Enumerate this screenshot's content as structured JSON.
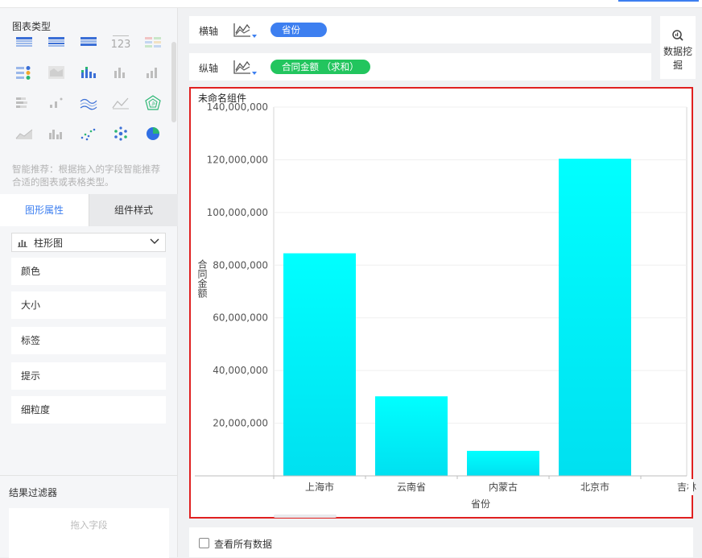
{
  "left_panel": {
    "chart_types_title": "图表类型",
    "hint": "智能推荐：根据拖入的字段智能推荐合适的图表或表格类型。",
    "tabs": [
      "图形属性",
      "组件样式"
    ],
    "chart_select": "柱形图",
    "properties": [
      "颜色",
      "大小",
      "标签",
      "提示",
      "细粒度"
    ],
    "filter_title": "结果过滤器",
    "filter_placeholder": "拖入字段",
    "icon_names": [
      "cross-table-icon",
      "group-table-icon",
      "detail-table-icon",
      "kpi-number-icon",
      "colored-table-icon",
      "multi-indicator-icon",
      "map-icon",
      "stacked-bar-icon",
      "bar-chart-icon",
      "column-chart-icon",
      "range-bar-icon",
      "scatter-bar-icon",
      "multi-line-icon",
      "line-chart-icon",
      "radar-icon",
      "area-chart-icon",
      "grouped-column-icon",
      "scatter-icon",
      "bubble-icon",
      "pie-chart-icon"
    ],
    "icon_123_text": "123"
  },
  "axes": {
    "x_label": "横轴",
    "x_field": "省份",
    "y_label": "纵轴",
    "y_field": "合同金额 （求和）"
  },
  "data_mining": "数据挖掘",
  "component_title": "未命名组件",
  "show_all_data": "查看所有数据",
  "colors": {
    "accent": "#3d7ff0",
    "green": "#22c55e",
    "bar_top": "#00ffff",
    "bar_bottom": "#00e0f0",
    "highlight": "#e02020"
  },
  "chart_data": {
    "type": "bar",
    "categories": [
      "上海市",
      "云南省",
      "内蒙古",
      "北京市",
      "吉林"
    ],
    "values": [
      84500000,
      30200000,
      9500000,
      120400000,
      null
    ],
    "xlabel": "省份",
    "ylabel": "合同金额",
    "ylim": [
      0,
      140000000
    ],
    "yticks": [
      "20,000,000",
      "40,000,000",
      "60,000,000",
      "80,000,000",
      "100,000,000",
      "120,000,000",
      "140,000,000"
    ],
    "ytick_values": [
      20000000,
      40000000,
      60000000,
      80000000,
      100000000,
      120000000,
      140000000
    ],
    "grid": true
  }
}
